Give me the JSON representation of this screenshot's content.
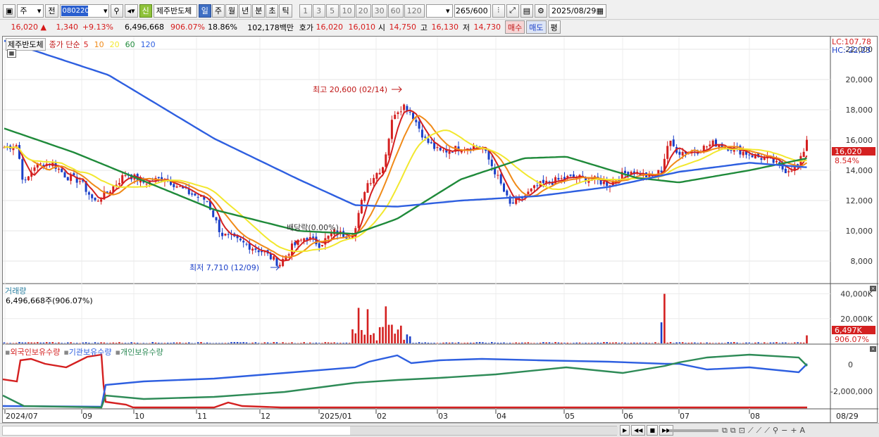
{
  "toolbar": {
    "market_type": "주",
    "prev_label": "전",
    "stock_code": "080220",
    "credit_badge": "신",
    "stock_name": "제주반도체",
    "period_tabs": [
      "일",
      "주",
      "월",
      "년",
      "분",
      "초",
      "틱"
    ],
    "selected_period": "일",
    "interval_buttons": [
      "1",
      "3",
      "5",
      "10",
      "20",
      "30",
      "60",
      "120"
    ],
    "count_value": "265",
    "count_total": "/600",
    "date": "2025/08/29"
  },
  "quote": {
    "price": "16,020",
    "change": "1,340",
    "change_pct": "+9.13%",
    "volume": "6,496,668",
    "volume_ratio": "906.07%",
    "turnover": "18.86%",
    "trade_value": "102,178백만",
    "ask_label": "호가",
    "ask_price": "16,020",
    "bid_price": "16,010",
    "open_label": "시",
    "open": "14,750",
    "high_label": "고",
    "high": "16,130",
    "low_label": "저",
    "low": "14,730",
    "buy_label": "매수",
    "sell_label": "매도",
    "avg_label": "평"
  },
  "main_chart": {
    "legend_name": "제주반도체",
    "legend_type": "종가 단순",
    "ma_periods": [
      "5",
      "10",
      "20",
      "60",
      "120"
    ],
    "ma_colors": [
      "#d42020",
      "#f08a18",
      "#f2e82e",
      "#1f8a3a",
      "#2e5fe0"
    ],
    "lc_label": "LC:107,78",
    "hc_label": "HC:-22,23",
    "y_ticks": [
      "22,000",
      "20,000",
      "18,000",
      "16,000",
      "14,000",
      "12,000",
      "10,000",
      "8,000"
    ],
    "high_annotation": "최고 20,600 (02/14)",
    "low_annotation": "최저 7,710 (12/09)",
    "dividend_annotation": "배당락(0.00%)",
    "last_price_tag": "16,020",
    "last_pct_tag": "8.54%"
  },
  "volume_chart": {
    "title": "거래량",
    "value_label": "6,496,668주(906.07%)",
    "y_ticks": [
      "40,000K",
      "20,000K",
      "0"
    ],
    "last_tag": "6,497K",
    "last_pct": "906.07%"
  },
  "holding_chart": {
    "series": [
      "외국인보유수량",
      "기관보유수량",
      "개인보유수량"
    ],
    "colors": [
      "#d42020",
      "#2e5fe0",
      "#2e8b57"
    ],
    "y_ticks": [
      "0",
      "-2,000,000"
    ]
  },
  "x_axis": {
    "labels": [
      "2024/07",
      "09",
      "10",
      "11",
      "12",
      "2025/01",
      "02",
      "03",
      "04",
      "05",
      "06",
      "07",
      "08"
    ],
    "right_label": "08/29"
  }
}
